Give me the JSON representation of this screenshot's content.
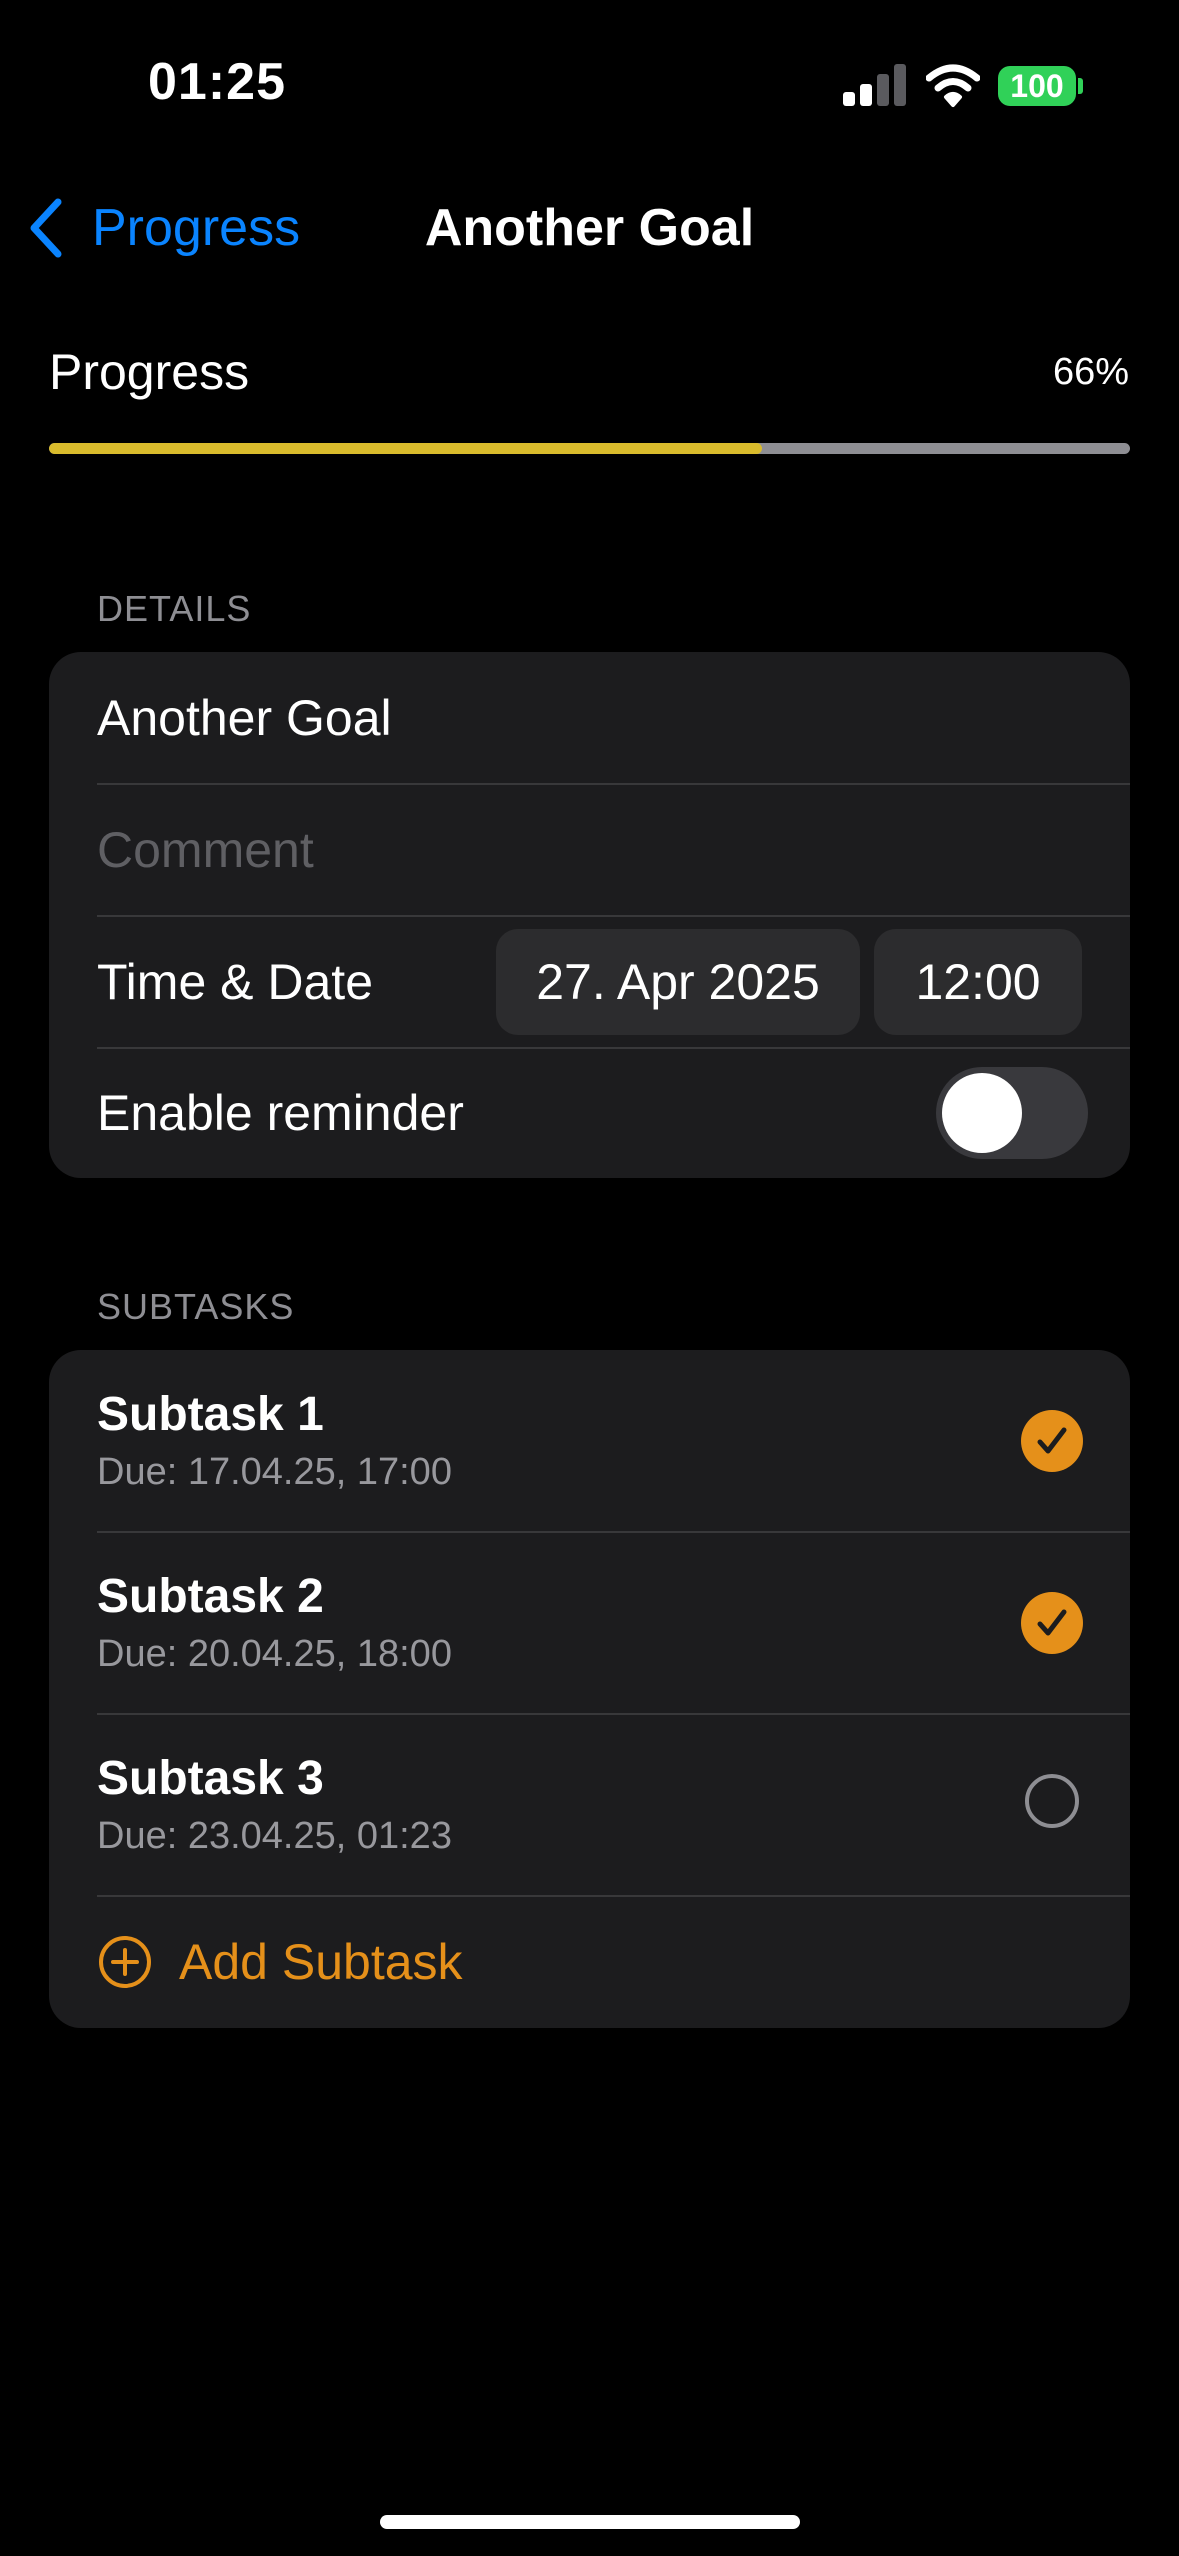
{
  "colors": {
    "accent": "#e5901a",
    "link": "#0a84ff",
    "progress_fill": "#d9bb2c",
    "battery": "#30d158"
  },
  "status_bar": {
    "time": "01:25",
    "battery": "100",
    "icons": [
      "cellular-signal-icon",
      "wifi-icon",
      "battery-icon"
    ]
  },
  "nav": {
    "back_label": "Progress",
    "title": "Another Goal"
  },
  "progress": {
    "label": "Progress",
    "percent_text": "66%",
    "fraction": 0.66
  },
  "details": {
    "header": "DETAILS",
    "goal_name": "Another Goal",
    "comment_placeholder": "Comment",
    "time_date_label": "Time & Date",
    "date": "27. Apr 2025",
    "time": "12:00",
    "reminder_label": "Enable reminder",
    "reminder_enabled": false
  },
  "subtasks": {
    "header": "SUBTASKS",
    "items": [
      {
        "title": "Subtask 1",
        "due": "Due: 17.04.25, 17:00",
        "done": true
      },
      {
        "title": "Subtask 2",
        "due": "Due: 20.04.25, 18:00",
        "done": true
      },
      {
        "title": "Subtask 3",
        "due": "Due: 23.04.25, 01:23",
        "done": false
      }
    ],
    "add_label": "Add Subtask"
  }
}
